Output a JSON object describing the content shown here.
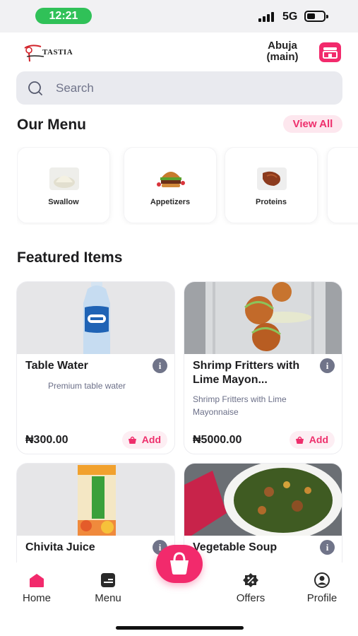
{
  "status_bar": {
    "time": "12:21",
    "network": "5G"
  },
  "header": {
    "logo_text": "TASTIA",
    "location_line1": "Abuja",
    "location_line2": "(main)"
  },
  "search": {
    "placeholder": "Search"
  },
  "menu": {
    "title": "Our Menu",
    "view_all": "View All",
    "categories": [
      {
        "label": "Swallow"
      },
      {
        "label": "Appetizers"
      },
      {
        "label": "Proteins"
      }
    ]
  },
  "featured": {
    "title": "Featured Items",
    "add_label": "Add",
    "items": [
      {
        "name": "Table Water",
        "description": "Premium table water",
        "price": "₦300.00"
      },
      {
        "name": "Shrimp Fritters with Lime Mayon...",
        "description": "Shrimp Fritters with Lime Mayonnaise",
        "price": "₦5000.00"
      },
      {
        "name": "Chivita Juice"
      },
      {
        "name": "Vegetable Soup"
      }
    ]
  },
  "bottom_nav": {
    "items": [
      {
        "label": "Home",
        "icon": "home-icon"
      },
      {
        "label": "Menu",
        "icon": "menu-icon"
      },
      {
        "label": "Offers",
        "icon": "offers-icon"
      },
      {
        "label": "Profile",
        "icon": "profile-icon"
      }
    ]
  },
  "colors": {
    "accent": "#f22a6c",
    "status_pill": "#30c158",
    "search_bg": "#e9eaef"
  }
}
